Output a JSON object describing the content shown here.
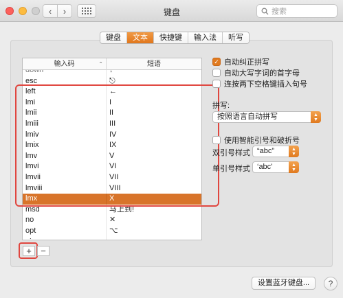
{
  "window": {
    "title": "键盘"
  },
  "search": {
    "placeholder": "搜索"
  },
  "tabs": [
    {
      "label": "键盘",
      "active": false
    },
    {
      "label": "文本",
      "active": true
    },
    {
      "label": "快捷键",
      "active": false
    },
    {
      "label": "输入法",
      "active": false
    },
    {
      "label": "听写",
      "active": false
    }
  ],
  "table": {
    "headers": {
      "code": "输入码",
      "phrase": "短语"
    },
    "partial_top": {
      "code": "down",
      "phrase": "↓"
    },
    "rows": [
      {
        "code": "esc",
        "phrase": "⎋",
        "selected": false
      },
      {
        "code": "left",
        "phrase": "←",
        "selected": false
      },
      {
        "code": "lmi",
        "phrase": "I",
        "selected": false
      },
      {
        "code": "lmii",
        "phrase": "II",
        "selected": false
      },
      {
        "code": "lmiii",
        "phrase": "III",
        "selected": false
      },
      {
        "code": "lmiv",
        "phrase": "IV",
        "selected": false
      },
      {
        "code": "lmix",
        "phrase": "IX",
        "selected": false
      },
      {
        "code": "lmv",
        "phrase": "V",
        "selected": false
      },
      {
        "code": "lmvi",
        "phrase": "VI",
        "selected": false
      },
      {
        "code": "lmvii",
        "phrase": "VII",
        "selected": false
      },
      {
        "code": "lmviii",
        "phrase": "VIII",
        "selected": false
      },
      {
        "code": "lmx",
        "phrase": "X",
        "selected": true
      },
      {
        "code": "msd",
        "phrase": "马上到!",
        "selected": false
      },
      {
        "code": "no",
        "phrase": "✕",
        "selected": false
      },
      {
        "code": "opt",
        "phrase": "⌥",
        "selected": false
      },
      {
        "code": "pi",
        "phrase": "π",
        "selected": false
      }
    ]
  },
  "buttons": {
    "add": "+",
    "remove": "−",
    "bluetooth": "设置蓝牙键盘...",
    "help": "?"
  },
  "options": {
    "autocorrect": {
      "label": "自动纠正拼写",
      "checked": true
    },
    "autocap": {
      "label": "自动大写字词的首字母",
      "checked": false
    },
    "doublespace": {
      "label": "连按两下空格键插入句号",
      "checked": false
    },
    "spelling_label": "拼写:",
    "spelling_value": "按照语言自动拼写",
    "smartquotes": {
      "label": "使用智能引号和破折号",
      "checked": false
    },
    "double_quote_label": "双引号样式",
    "double_quote_value": "“abc”",
    "single_quote_label": "单引号样式",
    "single_quote_value": "‘abc’"
  },
  "colors": {
    "accent": "#e07a1f",
    "highlight": "#e0463f",
    "selection": "#d8742a"
  }
}
